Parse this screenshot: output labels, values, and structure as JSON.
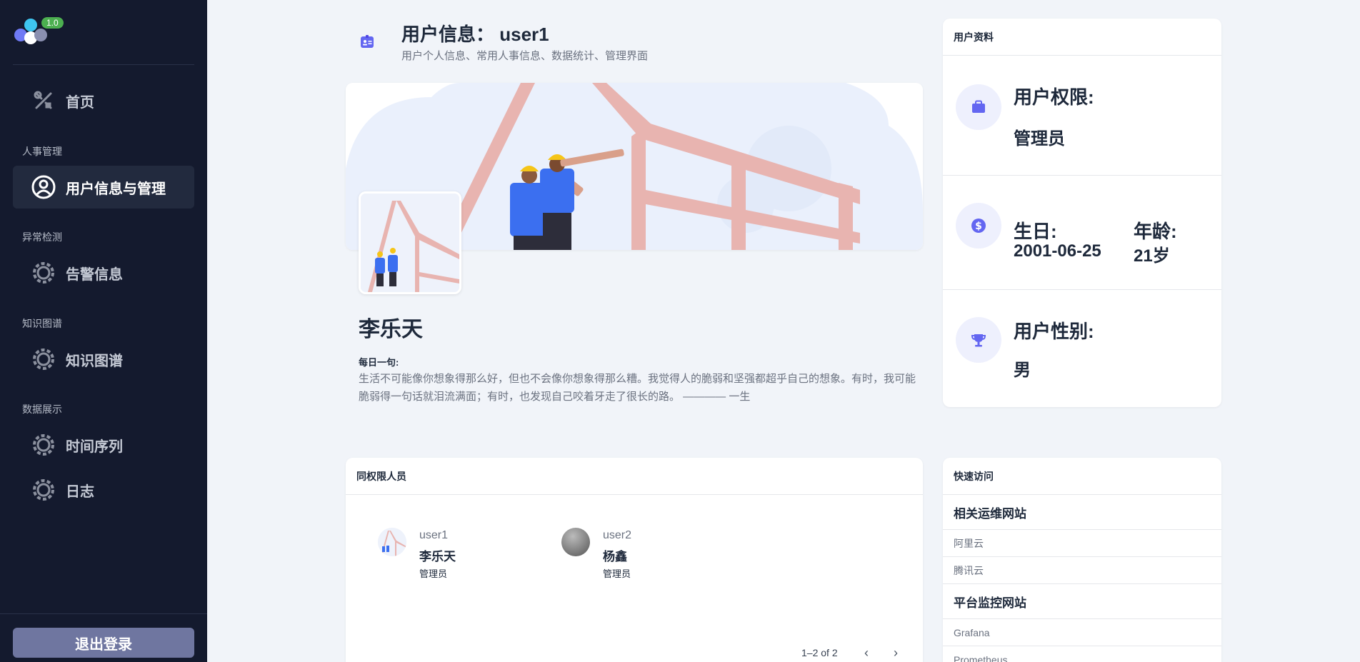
{
  "logo": {
    "version": "1.0"
  },
  "sidebar": {
    "home": {
      "label": "首页",
      "icon": "tools-icon"
    },
    "sections": [
      {
        "title": "人事管理",
        "items": [
          {
            "label": "用户信息与管理",
            "icon": "user-circle-icon",
            "active": true
          }
        ]
      },
      {
        "title": "异常检测",
        "items": [
          {
            "label": "告警信息",
            "icon": "gear-icon"
          }
        ]
      },
      {
        "title": "知识图谱",
        "items": [
          {
            "label": "知识图谱",
            "icon": "gear-icon"
          }
        ]
      },
      {
        "title": "数据展示",
        "items": [
          {
            "label": "时间序列",
            "icon": "gear-icon"
          },
          {
            "label": "日志",
            "icon": "gear-icon"
          }
        ]
      }
    ],
    "logout_label": "退出登录"
  },
  "header": {
    "title": "用户信息： user1",
    "subtitle": "用户个人信息、常用人事信息、数据统计、管理界面",
    "icon": "id-badge-icon"
  },
  "profile": {
    "name": "李乐天",
    "motto_label": "每日一句:",
    "motto": "生活不可能像你想象得那么好，但也不会像你想象得那么糟。我觉得人的脆弱和坚强都超乎自己的想象。有时，我可能脆弱得一句话就泪流满面；有时，也发现自己咬着牙走了很长的路。 ———— 一生"
  },
  "user_card": {
    "title": "用户资料",
    "permission_label": "用户权限:",
    "permission_value": "管理员",
    "birthday_label": "生日:",
    "birthday_value": "2001-06-25",
    "age_label": "年龄:",
    "age_value": "21岁",
    "gender_label": "用户性别:",
    "gender_value": "男"
  },
  "peers": {
    "title": "同权限人员",
    "members": [
      {
        "uid": "user1",
        "name": "李乐天",
        "role": "管理员"
      },
      {
        "uid": "user2",
        "name": "杨鑫",
        "role": "管理员"
      }
    ],
    "pagination": "1–2 of 2"
  },
  "quick_access": {
    "title": "快速访问",
    "groups": [
      {
        "title": "相关运维网站",
        "links": [
          "阿里云",
          "腾讯云"
        ]
      },
      {
        "title": "平台监控网站",
        "links": [
          "Grafana",
          "Prometheus"
        ]
      }
    ]
  },
  "colors": {
    "sidebar_bg": "#141a2e",
    "accent": "#6366f1",
    "logout_bg": "#6f76a0",
    "page_bg": "#f1f4f9"
  }
}
